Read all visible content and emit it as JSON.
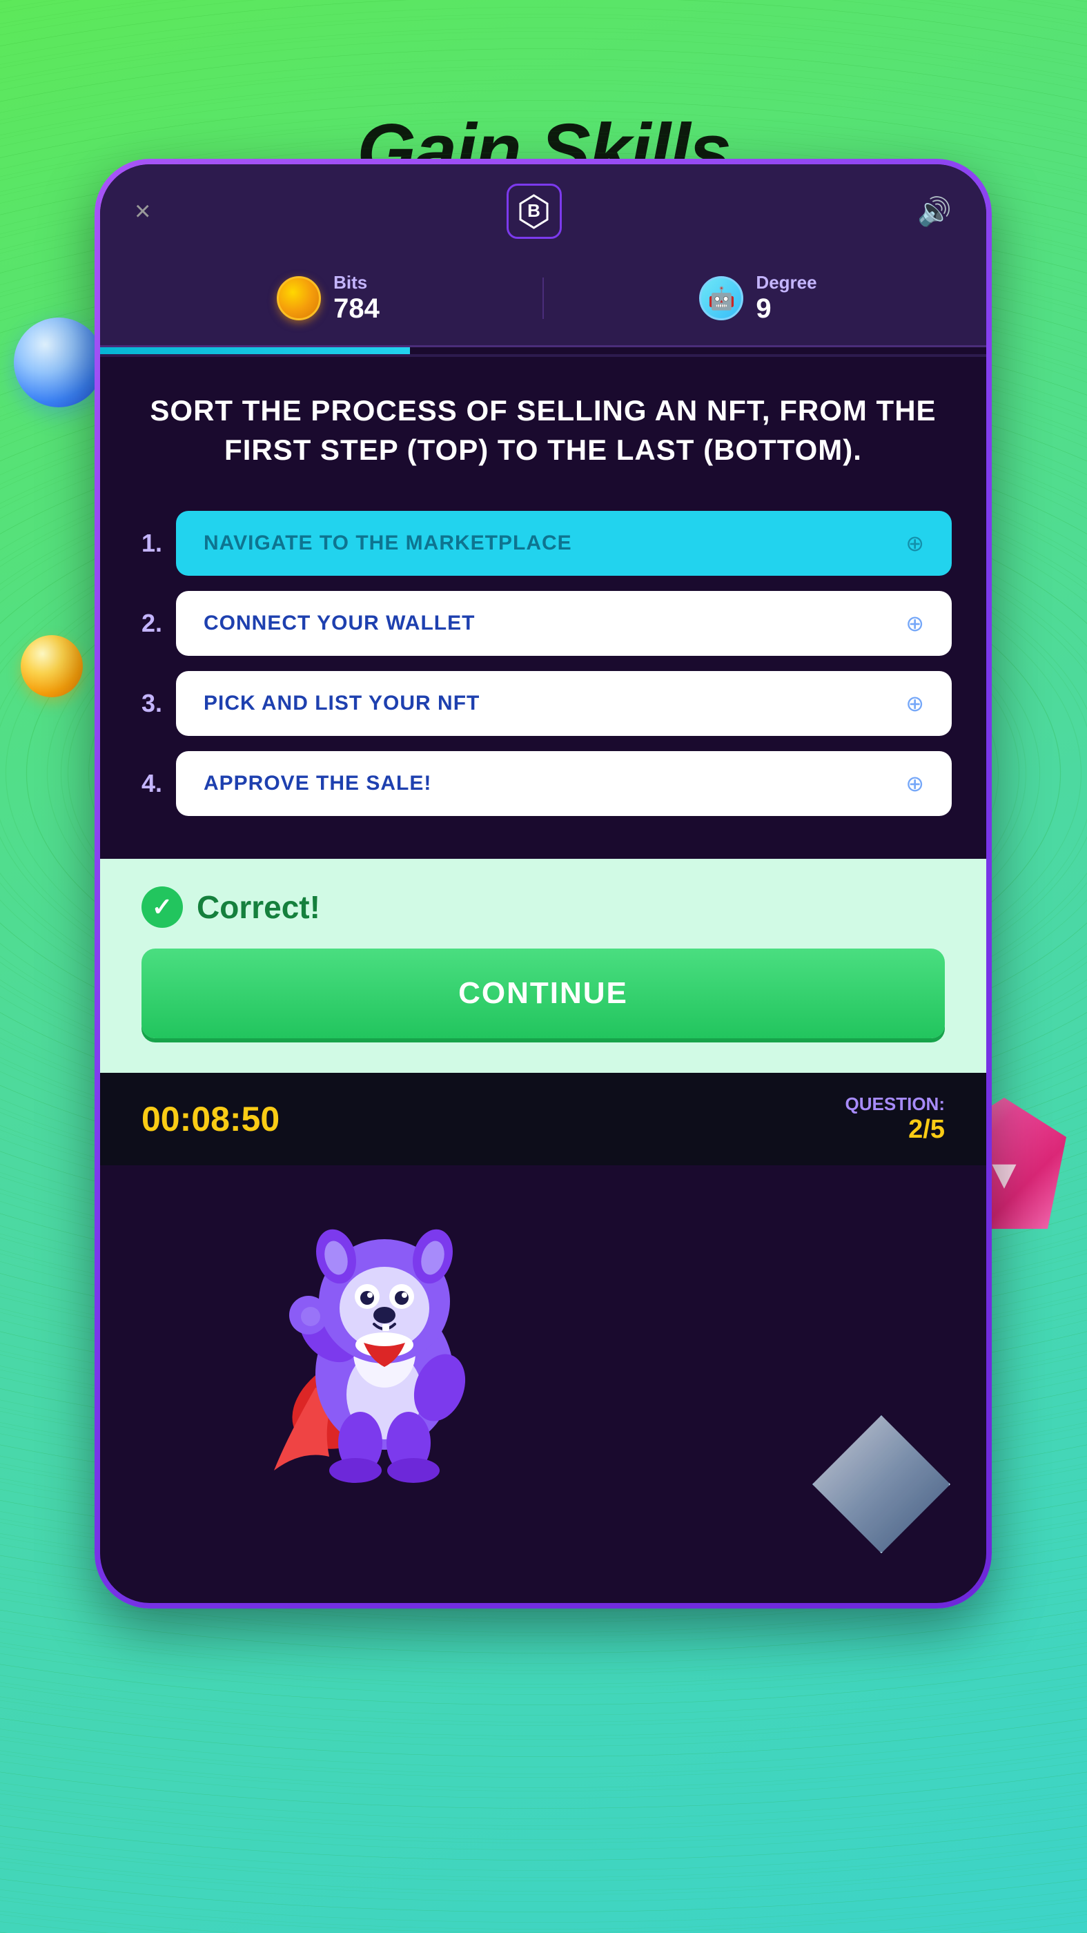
{
  "page": {
    "title": "Gain Skills",
    "background_gradient_start": "#5de85a",
    "background_gradient_end": "#3dd4c8"
  },
  "header": {
    "close_label": "×",
    "logo_label": "B",
    "sound_label": "🔊"
  },
  "stats": {
    "bits_label": "Bits",
    "bits_value": "784",
    "degree_label": "Degree",
    "degree_value": "9"
  },
  "progress": {
    "fill_percent": 35
  },
  "question": {
    "text": "SORT THE PROCESS OF SELLING AN NFT, FROM THE FIRST STEP (TOP) TO THE LAST (BOTTOM)."
  },
  "sort_items": [
    {
      "number": "1.",
      "label": "NAVIGATE TO THE MARKETPLACE",
      "state": "active"
    },
    {
      "number": "2.",
      "label": "CONNECT YOUR WALLET",
      "state": "inactive"
    },
    {
      "number": "3.",
      "label": "PICK AND LIST YOUR NFT",
      "state": "inactive"
    },
    {
      "number": "4.",
      "label": "APPROVE THE SALE!",
      "state": "inactive"
    }
  ],
  "feedback": {
    "correct_label": "Correct!",
    "continue_label": "CO"
  },
  "bottom_bar": {
    "timer": "00:08:50",
    "question_label": "QUESTION:",
    "question_value": "2/5"
  }
}
